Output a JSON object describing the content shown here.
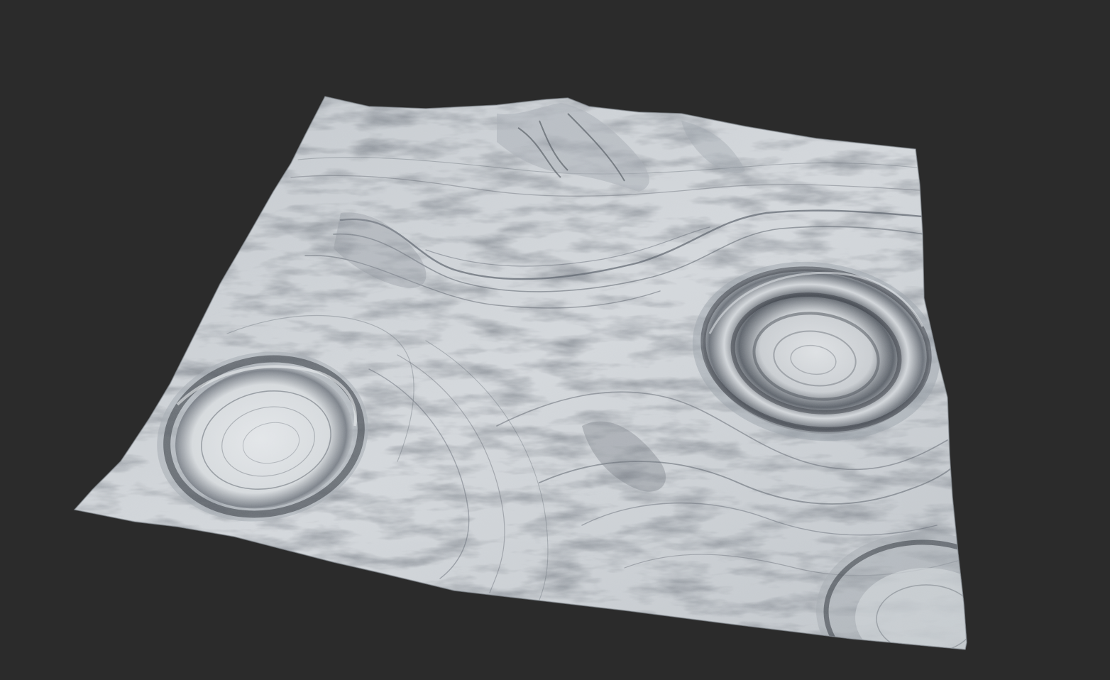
{
  "scene": {
    "background_color": "#2b2b2b",
    "subject": "terrain-heightfield-render",
    "surface_color": "#c9ced3",
    "shadow_color": "#2f343c",
    "highlight_color": "#e6e9ec",
    "features": [
      "crater-left",
      "crater-right",
      "crater-bottom-right-partial",
      "ridge-top",
      "strata-bands"
    ]
  }
}
